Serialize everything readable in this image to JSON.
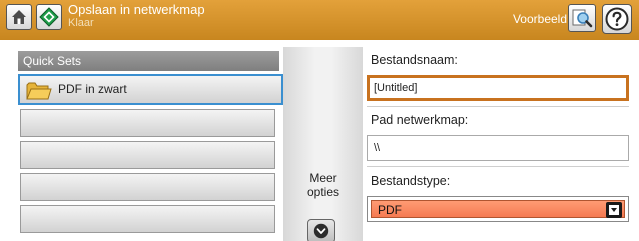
{
  "header": {
    "title": "Opslaan in netwerkmap",
    "subtitle": "Klaar",
    "preview_label": "Voorbeeld",
    "colors": {
      "bar": "#d89430"
    }
  },
  "quick_sets": {
    "header": "Quick Sets",
    "items": [
      {
        "label": "PDF in zwart",
        "icon": "folder-icon",
        "selected": true
      },
      {
        "label": ""
      },
      {
        "label": ""
      },
      {
        "label": ""
      },
      {
        "label": ""
      }
    ]
  },
  "middle": {
    "more_options": "Meer\nopties"
  },
  "form": {
    "filename_label": "Bestandsnaam:",
    "filename_value": "[Untitled]",
    "path_label": "Pad netwerkmap:",
    "path_value": "\\\\",
    "filetype_label": "Bestandstype:",
    "filetype_value": "PDF",
    "colors": {
      "active_border": "#c8721f",
      "select_fill": "#f7855e"
    }
  }
}
